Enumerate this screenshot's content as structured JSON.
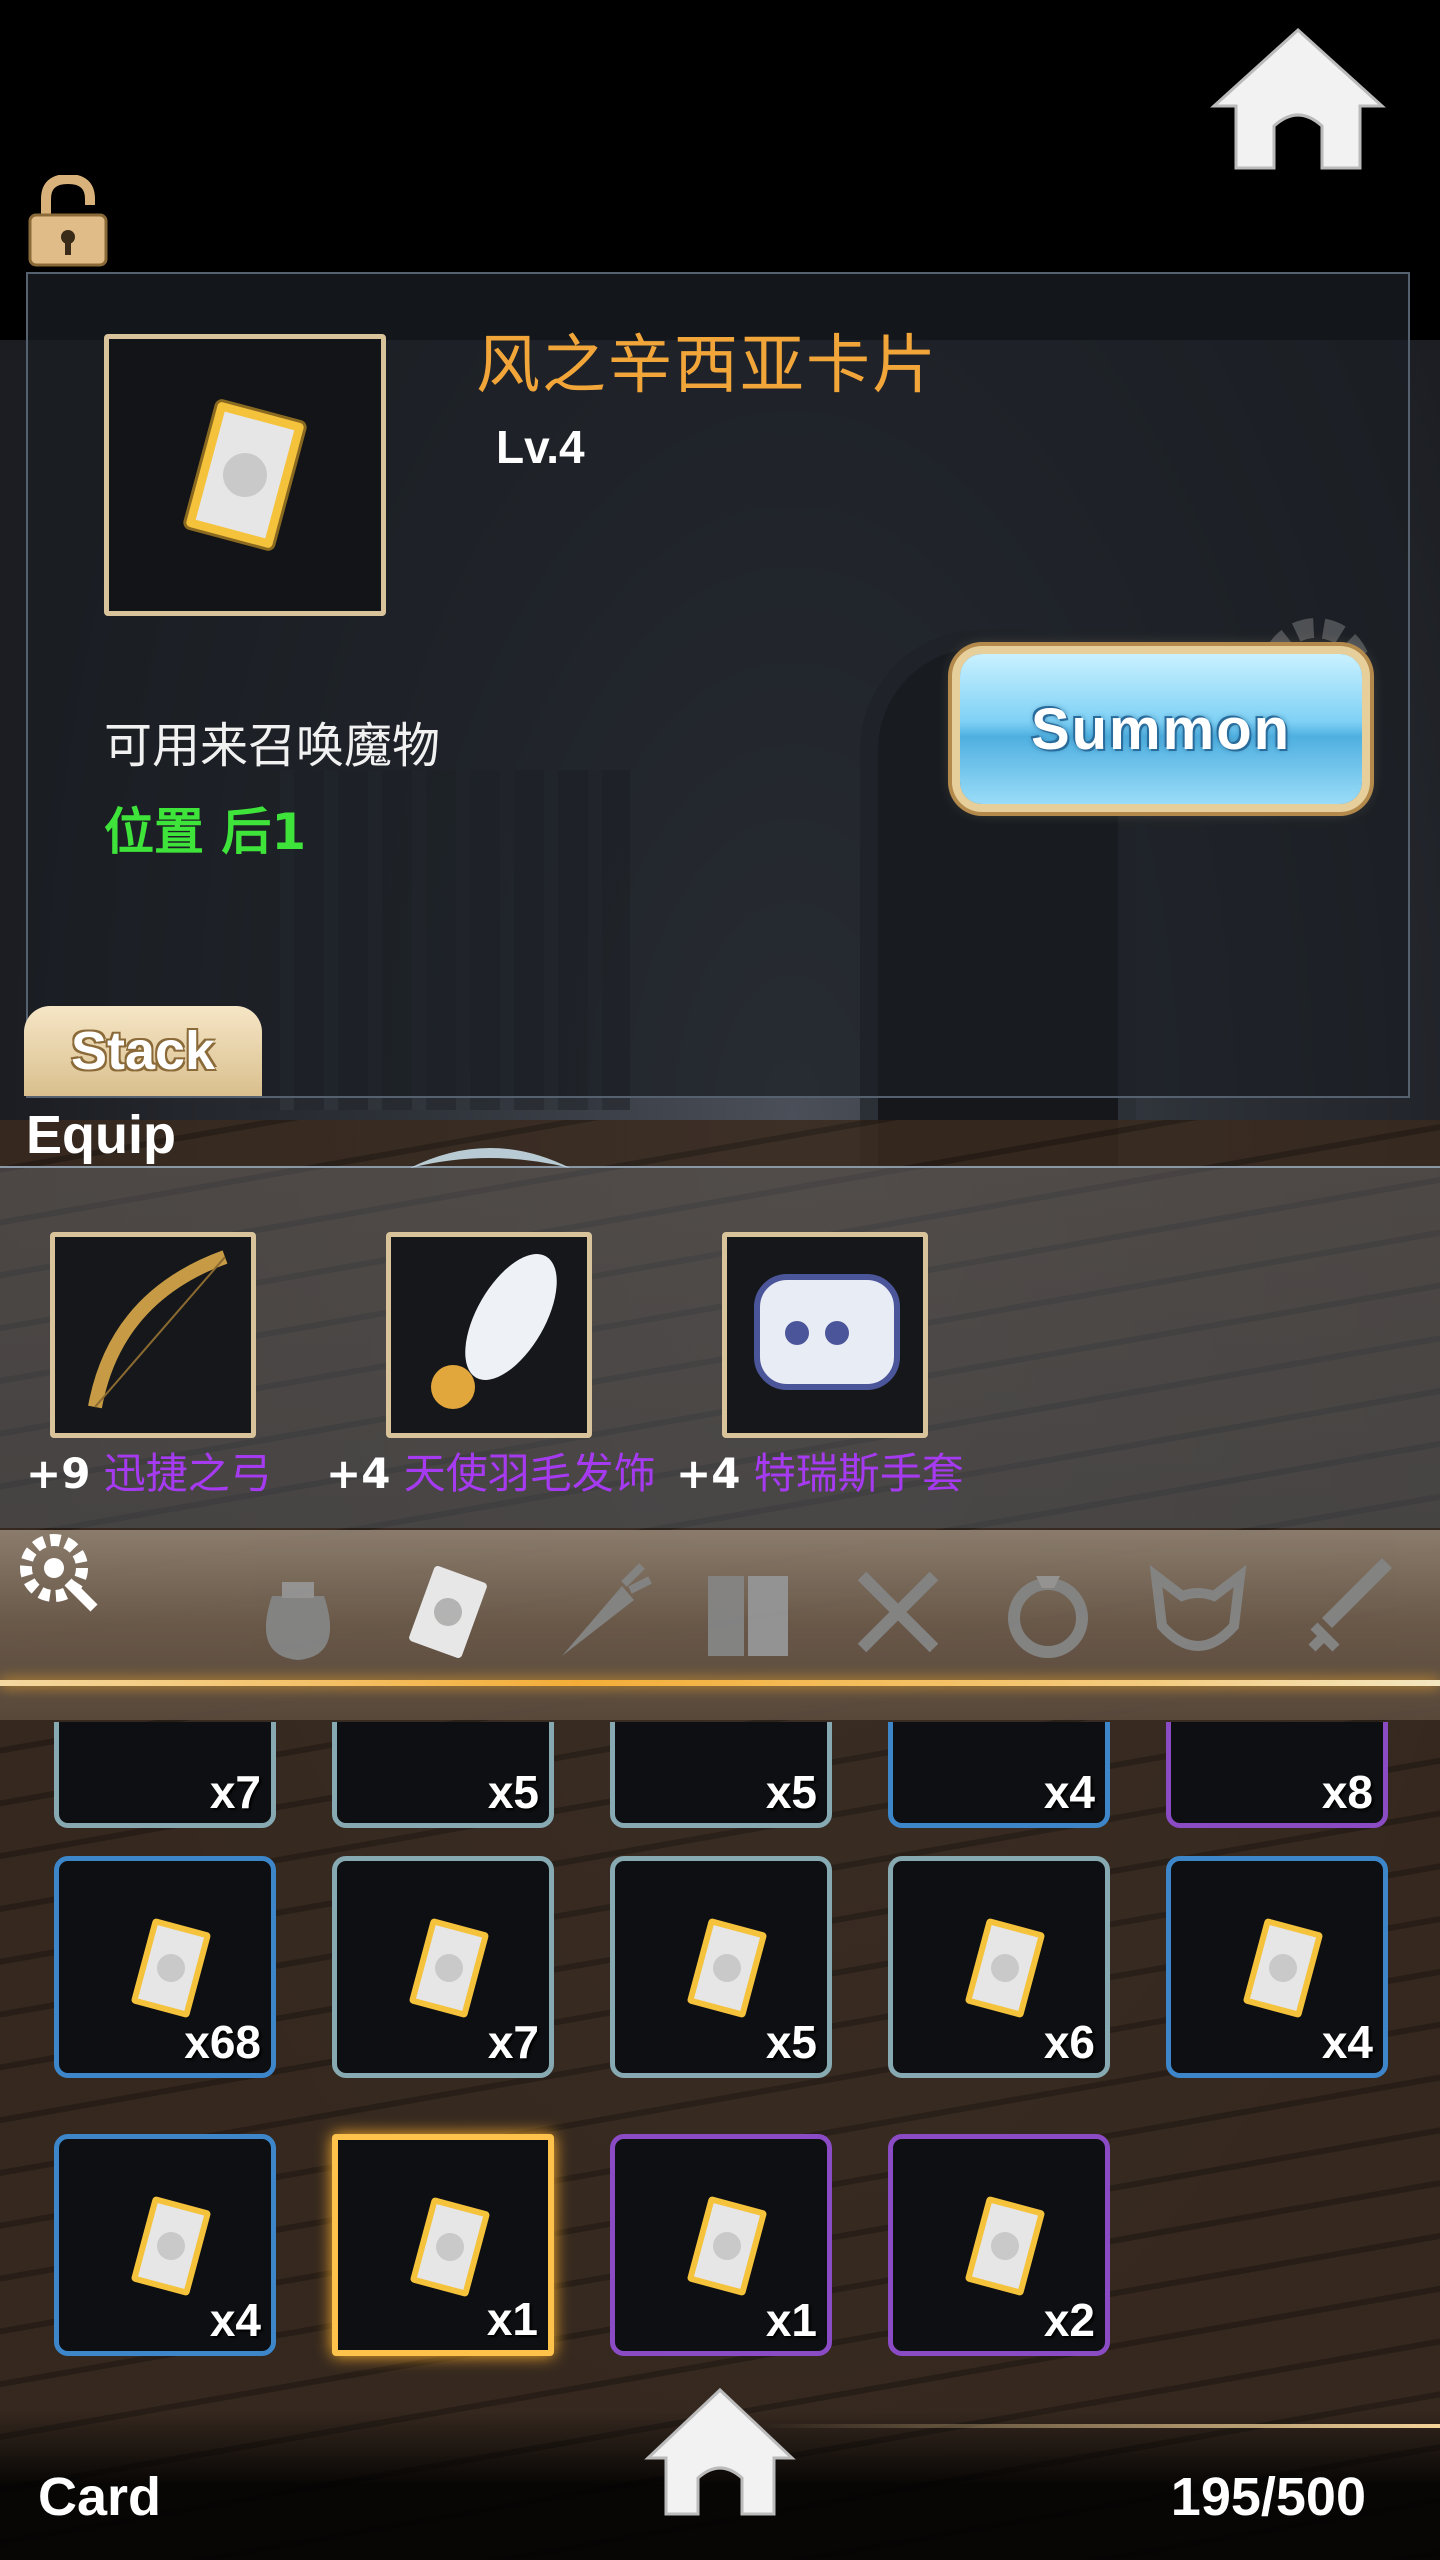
{
  "item": {
    "name": "风之辛西亚卡片",
    "level": "Lv.4",
    "description": "可用来召唤魔物",
    "position_label": "位置 后1"
  },
  "buttons": {
    "summon": "Summon",
    "stack": "Stack"
  },
  "equip": {
    "label": "Equip",
    "items": [
      {
        "plus": "+9",
        "name": "迅捷之弓",
        "icon": "bow-icon"
      },
      {
        "plus": "+4",
        "name": "天使羽毛发饰",
        "icon": "feather-hairpin-icon"
      },
      {
        "plus": "+4",
        "name": "特瑞斯手套",
        "icon": "gauntlet-icon"
      }
    ]
  },
  "categories": [
    "bag-icon",
    "card-icon",
    "carrot-icon",
    "book-icon",
    "utensils-icon",
    "ring-icon",
    "cat-ears-icon",
    "sword-icon"
  ],
  "inventory": {
    "row1": [
      "x7",
      "x5",
      "x5",
      "x4",
      "x8"
    ],
    "row2": [
      "x68",
      "x7",
      "x5",
      "x6",
      "x4"
    ],
    "row3": [
      "x4",
      "x1",
      "x1",
      "x2"
    ]
  },
  "footer": {
    "section": "Card",
    "capacity": "195/500"
  },
  "colors": {
    "title": "#f2a63a",
    "position": "#3fe43a",
    "equip_name": "#a63af0",
    "accent_gold": "#ffc24a"
  }
}
